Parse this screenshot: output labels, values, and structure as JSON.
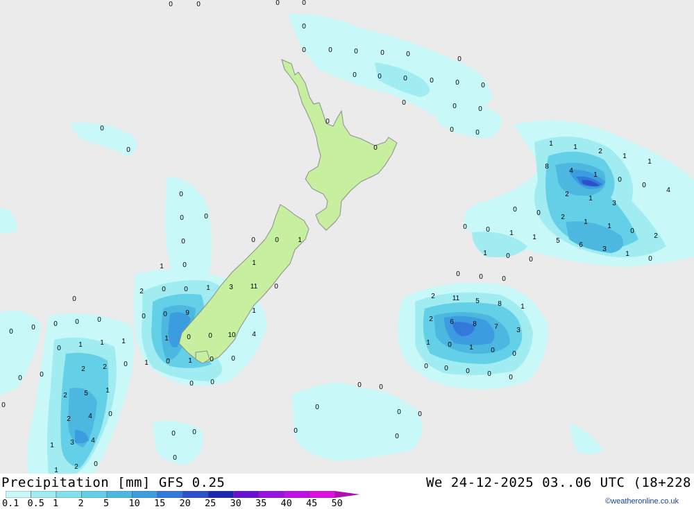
{
  "footer": {
    "title": "Precipitation [mm] GFS 0.25",
    "valid_time": "We 24-12-2025 03..06 UTC (18+228",
    "credit": "©weatheronline.co.uk"
  },
  "legend": {
    "labels": [
      "0.1",
      "0.5",
      "1",
      "2",
      "5",
      "10",
      "15",
      "20",
      "25",
      "30",
      "35",
      "40",
      "45",
      "50"
    ],
    "colors": [
      "#c8f8f8",
      "#a0ecf0",
      "#82e0ec",
      "#64d0e8",
      "#4cb8e0",
      "#3c9ce0",
      "#3478dc",
      "#2a50cc",
      "#1c28b4",
      "#6a10d4",
      "#9a12e0",
      "#c010e8",
      "#e010e0",
      "#b010b0"
    ]
  },
  "colors": {
    "background": "#ebebeb",
    "land": "#c6f0a0",
    "coast": "#8c8c8c",
    "light_rain": "#c8f8f8",
    "moderate_rain": "#82e0ec"
  },
  "values": [
    "0",
    "0",
    "0",
    "0",
    "0",
    "0",
    "0",
    "0",
    "0",
    "0",
    "0",
    "0",
    "0",
    "0",
    "0",
    "0",
    "0",
    "0",
    "0",
    "0",
    "0",
    "0",
    "0",
    "0",
    "0",
    "0",
    "0",
    "0",
    "0",
    "0",
    "0",
    "0",
    "0",
    "1",
    "1",
    "1",
    "2",
    "0",
    "0",
    "1",
    "3",
    "11",
    "0",
    "0",
    "9",
    "1",
    "0",
    "1",
    "0",
    "0",
    "10",
    "4",
    "1",
    "0",
    "1",
    "0",
    "0",
    "0",
    "0",
    "0",
    "0",
    "0",
    "0",
    "0",
    "0",
    "1",
    "1",
    "1",
    "0",
    "2",
    "2",
    "0",
    "0",
    "2",
    "5",
    "1",
    "2",
    "4",
    "0",
    "1",
    "3",
    "4",
    "2",
    "0",
    "1",
    "0",
    "0",
    "0",
    "0",
    "0",
    "0",
    "0",
    "0",
    "0",
    "0",
    "0",
    "0",
    "1",
    "1",
    "2",
    "1",
    "1",
    "8",
    "4",
    "1",
    "0",
    "0",
    "4",
    "2",
    "1",
    "3",
    "2",
    "1",
    "1",
    "0",
    "2",
    "1",
    "5",
    "6",
    "3",
    "1",
    "0",
    "0",
    "0",
    "0",
    "0",
    "1",
    "1",
    "0",
    "0",
    "0",
    "0",
    "0",
    "2",
    "11",
    "5",
    "8",
    "1",
    "2",
    "6",
    "8",
    "7",
    "3",
    "1",
    "0",
    "1",
    "0",
    "0",
    "0",
    "0",
    "0",
    "0",
    "0"
  ]
}
